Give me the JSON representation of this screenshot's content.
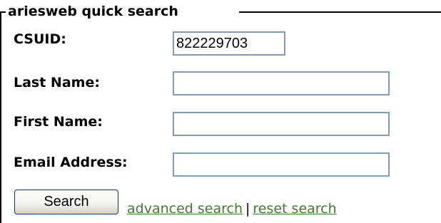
{
  "form": {
    "legend": "ariesweb quick search",
    "fields": [
      {
        "label": "CSUID:",
        "value": "822229703",
        "placeholder": ""
      },
      {
        "label": "Last Name:",
        "value": "",
        "placeholder": ""
      },
      {
        "label": "First Name:",
        "value": "",
        "placeholder": ""
      },
      {
        "label": "Email Address:",
        "value": "",
        "placeholder": ""
      }
    ],
    "search_button_label": "Search",
    "advanced_search_link": "advanced search",
    "separator": "|",
    "reset_search_link": "reset search"
  },
  "colors": {
    "link": "#3a7d2a",
    "input_border": "#7f9db9",
    "button_border": "#003c74"
  }
}
